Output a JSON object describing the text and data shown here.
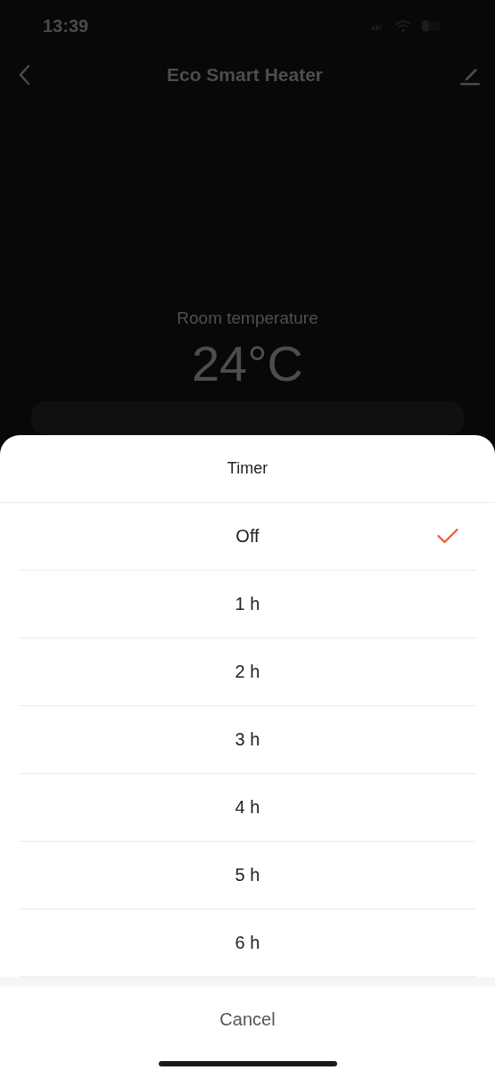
{
  "status_bar": {
    "time": "13:39"
  },
  "header": {
    "title": "Eco Smart Heater"
  },
  "room": {
    "label": "Room temperature",
    "value": "24°C"
  },
  "sheet": {
    "title": "Timer",
    "options": [
      {
        "label": "Off",
        "selected": true
      },
      {
        "label": "1 h",
        "selected": false
      },
      {
        "label": "2 h",
        "selected": false
      },
      {
        "label": "3 h",
        "selected": false
      },
      {
        "label": "4 h",
        "selected": false
      },
      {
        "label": "5 h",
        "selected": false
      },
      {
        "label": "6 h",
        "selected": false
      }
    ],
    "cancel": "Cancel"
  }
}
